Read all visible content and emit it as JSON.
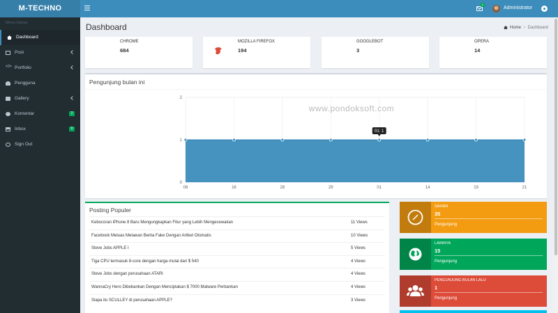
{
  "app": {
    "logo": "M-TECHNO"
  },
  "header": {
    "mail_badge": "0",
    "user_name": "Administrator"
  },
  "sidebar": {
    "header": "Menu Utama",
    "items": [
      {
        "label": "Dashboard"
      },
      {
        "label": "Post"
      },
      {
        "label": "Portfolio"
      },
      {
        "label": "Pengguna"
      },
      {
        "label": "Gallery"
      },
      {
        "label": "Komentar",
        "badge": "2"
      },
      {
        "label": "Inbox",
        "badge": "0"
      },
      {
        "label": "Sign Out"
      }
    ]
  },
  "page": {
    "title": "Dashboard"
  },
  "breadcrumb": {
    "home": "Home",
    "current": "Dashboard"
  },
  "browser_stats": [
    {
      "name": "CHROME",
      "count": "684",
      "color": "#00c0ef",
      "icon": "chrome-icon"
    },
    {
      "name": "MOZILLA FIREFOX",
      "count": "194",
      "color": "#dd4b39",
      "icon": "firefox-icon"
    },
    {
      "name": "GOOGLEBOT",
      "count": "3",
      "color": "#00a65a",
      "icon": "bug-icon"
    },
    {
      "name": "OPERA",
      "count": "14",
      "color": "#f39c12",
      "icon": "opera-icon"
    }
  ],
  "visitors": {
    "title": "Pengunjung bulan ini",
    "watermark": "www.pondoksoft.com",
    "tooltip": "01: 1",
    "chart_data": {
      "type": "area",
      "x": [
        "08",
        "16",
        "28",
        "29",
        "01",
        "14",
        "19",
        "21"
      ],
      "values": [
        1,
        1,
        1,
        1,
        1,
        1,
        1,
        1
      ],
      "yticks": [
        "0",
        "1",
        "2"
      ],
      "ylim": [
        0,
        2
      ],
      "grid": true,
      "color": "#3c8dbc"
    }
  },
  "popular": {
    "title": "Posting Populer",
    "posts": [
      {
        "title": "Kebocoran iPhone 8 Baru Mengungkapkan Fitur yang Lebih Mengecewakan",
        "views": "11 Views"
      },
      {
        "title": "Facebook Meluas Melawan Berita Fake Dengan Artikel Otomatis",
        "views": "10 Views"
      },
      {
        "title": "Steve Jobs APPLE I",
        "views": "5 Views"
      },
      {
        "title": "Tiga CPU termasuk 8-core dengan harga mulai dari $ 540",
        "views": "4 Views"
      },
      {
        "title": "Steve Jobs dengan perusahaan ATARI",
        "views": "4 Views"
      },
      {
        "title": "WannaCry Hero Dibebankan Dengan Menciptakan $ 7000 Malware Perbankan",
        "views": "4 Views"
      },
      {
        "title": "Siapa itu SCULLEY di perusahaan APPLE?",
        "views": "3 Views"
      }
    ]
  },
  "visitor_stats": [
    {
      "name": "SAFARI",
      "count": "35",
      "desc": "Pengunjung",
      "color": "#f39c12",
      "icon": "compass-icon"
    },
    {
      "name": "LAINNYA",
      "count": "15",
      "desc": "Pengunjung",
      "color": "#00a65a",
      "icon": "globe-icon"
    },
    {
      "name": "PENGUNJUNG BULAN LALU",
      "count": "1",
      "desc": "Pengunjung",
      "color": "#dd4b39",
      "icon": "users-icon"
    }
  ]
}
